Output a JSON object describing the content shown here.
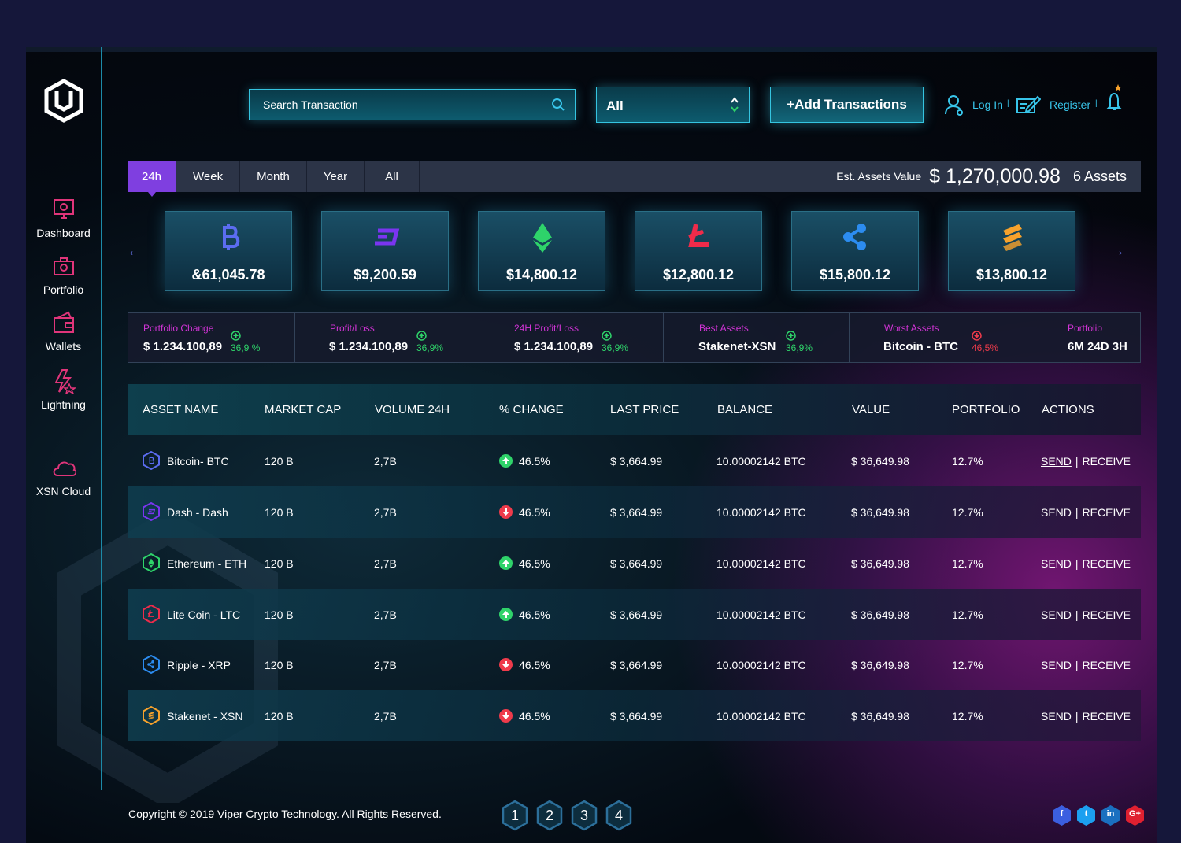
{
  "header": {
    "search_placeholder": "Search Transaction",
    "filter_value": "All",
    "add_button": "+Add Transactions",
    "login": "Log In",
    "register": "Register",
    "separator": "|"
  },
  "sidebar": {
    "items": [
      {
        "label": "Dashboard",
        "icon": "monitor-icon"
      },
      {
        "label": "Portfolio",
        "icon": "briefcase-icon"
      },
      {
        "label": "Wallets",
        "icon": "wallet-icon"
      },
      {
        "label": "Lightning",
        "icon": "lightning-icon"
      },
      {
        "label": "XSN Cloud",
        "icon": "cloud-icon"
      }
    ]
  },
  "tabs": [
    "24h",
    "Week",
    "Month",
    "Year",
    "All"
  ],
  "active_tab": "24h",
  "assets_summary": {
    "label": "Est. Assets Value",
    "value": "$ 1,270,000.98",
    "count": "6 Assets"
  },
  "cards": [
    {
      "coin": "bitcoin-icon",
      "value": "&61,045.78",
      "color": "#5b6cf0"
    },
    {
      "coin": "dash-icon",
      "value": "$9,200.59",
      "color": "#7a35f0"
    },
    {
      "coin": "ethereum-icon",
      "value": "$14,800.12",
      "color": "#2ed36a"
    },
    {
      "coin": "litecoin-icon",
      "value": "$12,800.12",
      "color": "#ef2b4a"
    },
    {
      "coin": "ripple-icon",
      "value": "$15,800.12",
      "color": "#2c8cf0"
    },
    {
      "coin": "stakenet-icon",
      "value": "$13,800.12",
      "color": "#f7a22c"
    }
  ],
  "stats": [
    {
      "title": "Portfolio Change",
      "value": "$ 1.234.100,89",
      "change": "36,9 %",
      "dir": "up"
    },
    {
      "title": "Profit/Loss",
      "value": "$ 1.234.100,89",
      "change": "36,9%",
      "dir": "up"
    },
    {
      "title": "24H Profit/Loss",
      "value": "$ 1.234.100,89",
      "change": "36,9%",
      "dir": "up"
    },
    {
      "title": "Best Assets",
      "value": "Stakenet-XSN",
      "change": "36,9%",
      "dir": "up"
    },
    {
      "title": "Worst Assets",
      "value": "Bitcoin - BTC",
      "change": "46,5%",
      "dir": "down"
    },
    {
      "title": "Portfolio",
      "value": "6M 24D 3H",
      "change": "",
      "dir": ""
    }
  ],
  "table": {
    "headers": [
      "ASSET NAME",
      "MARKET CAP",
      "VOLUME 24H",
      "% CHANGE",
      "LAST PRICE",
      "BALANCE",
      "VALUE",
      "PORTFOLIO",
      "ACTIONS"
    ],
    "rows": [
      {
        "name": "Bitcoin- BTC",
        "coin": "bitcoin-icon",
        "cap": "120 B",
        "vol": "2,7B",
        "change": "46.5%",
        "dir": "up",
        "price": "$ 3,664.99",
        "balance": "10.00002142 BTC",
        "value": "$ 36,649.98",
        "portfolio": "12.7%",
        "send": "SEND",
        "receive": "RECEIVE"
      },
      {
        "name": "Dash - Dash",
        "coin": "dash-icon",
        "cap": "120 B",
        "vol": "2,7B",
        "change": "46.5%",
        "dir": "down",
        "price": "$ 3,664.99",
        "balance": "10.00002142 BTC",
        "value": "$ 36,649.98",
        "portfolio": "12.7%",
        "send": "SEND",
        "receive": "RECEIVE"
      },
      {
        "name": "Ethereum - ETH",
        "coin": "ethereum-icon",
        "cap": "120 B",
        "vol": "2,7B",
        "change": "46.5%",
        "dir": "up",
        "price": "$ 3,664.99",
        "balance": "10.00002142 BTC",
        "value": "$ 36,649.98",
        "portfolio": "12.7%",
        "send": "SEND",
        "receive": "RECEIVE"
      },
      {
        "name": "Lite Coin - LTC",
        "coin": "litecoin-icon",
        "cap": "120 B",
        "vol": "2,7B",
        "change": "46.5%",
        "dir": "up",
        "price": "$ 3,664.99",
        "balance": "10.00002142 BTC",
        "value": "$ 36,649.98",
        "portfolio": "12.7%",
        "send": "SEND",
        "receive": "RECEIVE"
      },
      {
        "name": "Ripple - XRP",
        "coin": "ripple-icon",
        "cap": "120 B",
        "vol": "2,7B",
        "change": "46.5%",
        "dir": "down",
        "price": "$ 3,664.99",
        "balance": "10.00002142 BTC",
        "value": "$ 36,649.98",
        "portfolio": "12.7%",
        "send": "SEND",
        "receive": "RECEIVE"
      },
      {
        "name": "Stakenet - XSN",
        "coin": "stakenet-icon",
        "cap": "120 B",
        "vol": "2,7B",
        "change": "46.5%",
        "dir": "down",
        "price": "$ 3,664.99",
        "balance": "10.00002142 BTC",
        "value": "$ 36,649.98",
        "portfolio": "12.7%",
        "send": "SEND",
        "receive": "RECEIVE"
      }
    ]
  },
  "footer": {
    "copyright": "Copyright © 2019 Viper Crypto Technology. All Rights Reserved.",
    "pages": [
      "1",
      "2",
      "3",
      "4"
    ],
    "social": [
      {
        "icon": "facebook-icon",
        "glyph": "f",
        "color": "#3b5fe0"
      },
      {
        "icon": "twitter-icon",
        "glyph": "t",
        "color": "#1ca0f0"
      },
      {
        "icon": "linkedin-icon",
        "glyph": "in",
        "color": "#1a70c0"
      },
      {
        "icon": "google-plus-icon",
        "glyph": "G+",
        "color": "#e02030"
      }
    ]
  },
  "colors": {
    "accent": "#35c4e0",
    "tab_active": "#7f3fe0",
    "stat_title": "#d233d6",
    "up": "#2fd36a",
    "down": "#ef3b4b",
    "action": "#ea2f62"
  }
}
